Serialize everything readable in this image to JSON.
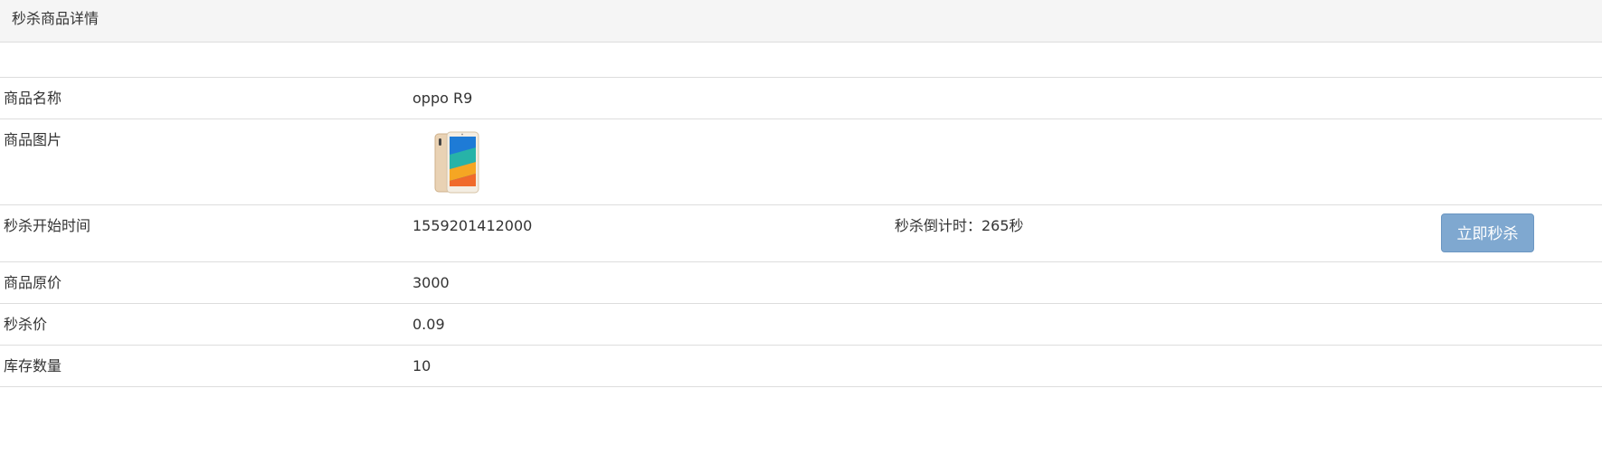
{
  "panel": {
    "title": "秒杀商品详情"
  },
  "goods": {
    "name_label": "商品名称",
    "name_value": "oppo R9",
    "image_label": "商品图片",
    "image_icon": "smartphone-product-image",
    "start_time_label": "秒杀开始时间",
    "start_time_value": "1559201412000",
    "countdown_text": "秒杀倒计时：265秒",
    "seckill_button_label": "立即秒杀",
    "original_price_label": "商品原价",
    "original_price_value": "3000",
    "seckill_price_label": "秒杀价",
    "seckill_price_value": "0.09",
    "stock_label": "库存数量",
    "stock_value": "10"
  },
  "colors": {
    "heading_bg": "#f5f5f5",
    "border": "#dddddd",
    "button_bg": "#7fa8d0",
    "text": "#333333"
  }
}
